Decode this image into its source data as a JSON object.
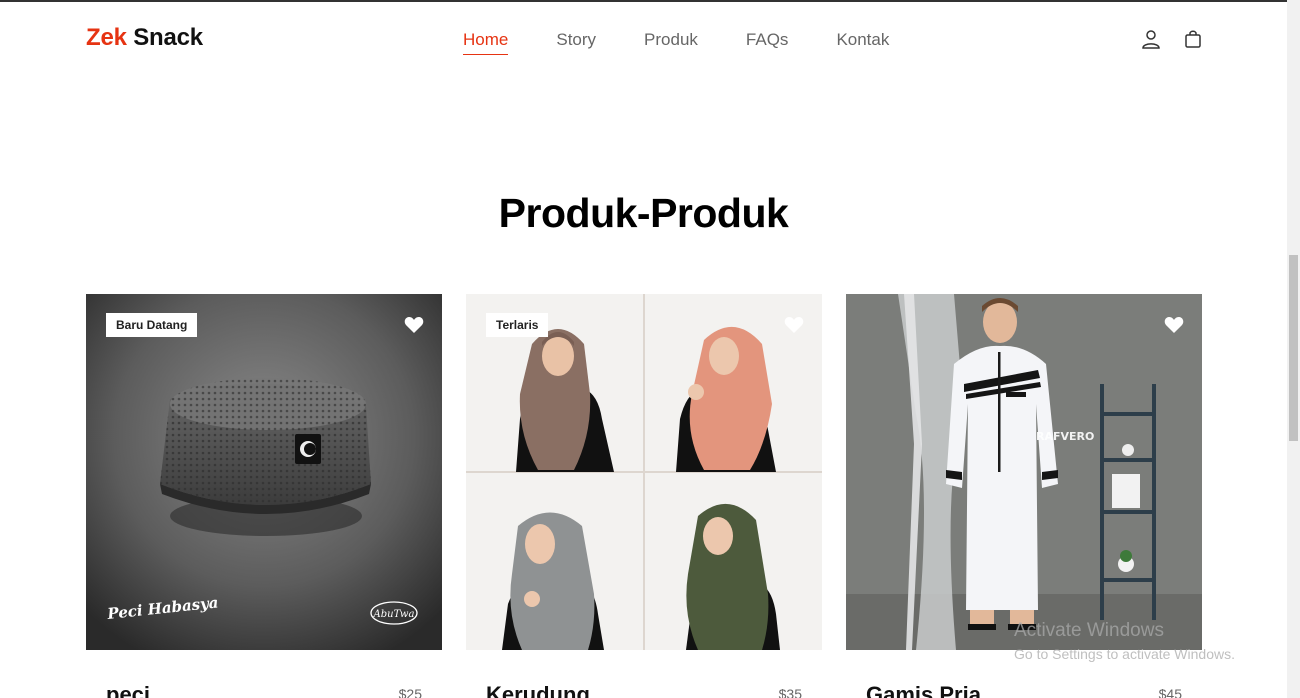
{
  "brand": {
    "accent": "Zek",
    "rest": "Snack",
    "accent_color": "#e63312"
  },
  "nav": {
    "items": [
      {
        "label": "Home",
        "active": true
      },
      {
        "label": "Story",
        "active": false
      },
      {
        "label": "Produk",
        "active": false
      },
      {
        "label": "FAQs",
        "active": false
      },
      {
        "label": "Kontak",
        "active": false
      }
    ]
  },
  "header_icons": [
    "user-icon",
    "shopping-bag-icon"
  ],
  "section": {
    "title": "Produk-Produk"
  },
  "products": [
    {
      "name": "peci",
      "price": "$25",
      "badge": "Baru Datang",
      "image": "peci-cap-photo",
      "overlay_left": "Peci Habasya",
      "overlay_right": "AbuTwa"
    },
    {
      "name": "Kerudung",
      "price": "$35",
      "badge": "Terlaris",
      "image": "hijab-collage-photo"
    },
    {
      "name": "Gamis Pria",
      "price": "$45",
      "badge": "",
      "image": "gamis-model-photo",
      "overlay_brand": "RAFVERO"
    }
  ],
  "os_watermark": {
    "line1": "Activate Windows",
    "line2": "Go to Settings to activate Windows."
  }
}
